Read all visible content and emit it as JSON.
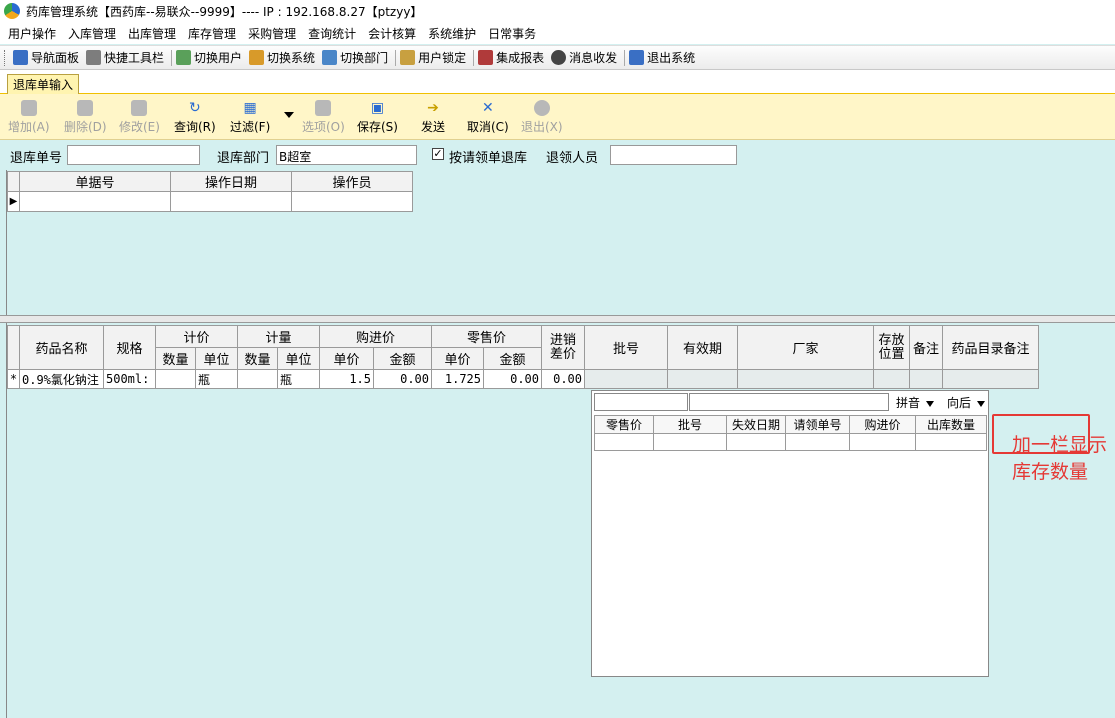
{
  "window": {
    "title": "药库管理系统【西药库--易联众--9999】---- IP : 192.168.8.27【ptzyy】"
  },
  "menu": [
    "用户操作",
    "入库管理",
    "出库管理",
    "库存管理",
    "采购管理",
    "查询统计",
    "会计核算",
    "系统维护",
    "日常事务"
  ],
  "toolbar": {
    "items": [
      {
        "label": "导航面板",
        "icon": "navigation-panel-icon",
        "color": "#3a6fc4"
      },
      {
        "label": "快捷工具栏",
        "icon": "shortcut-toolbar-icon",
        "color": "#7d7d7d"
      },
      {
        "label": "切换用户",
        "icon": "switch-user-icon",
        "color": "#5aa05a"
      },
      {
        "label": "切换系统",
        "icon": "switch-system-icon",
        "color": "#d89a2a"
      },
      {
        "label": "切换部门",
        "icon": "switch-department-icon",
        "color": "#4a86c8"
      },
      {
        "label": "用户锁定",
        "icon": "user-lock-icon",
        "color": "#c8a040"
      },
      {
        "label": "集成报表",
        "icon": "integrated-report-icon",
        "color": "#b03a3a"
      },
      {
        "label": "消息收发",
        "icon": "message-icon",
        "color": "#444444"
      },
      {
        "label": "退出系统",
        "icon": "exit-system-icon",
        "color": "#3a6fc4"
      }
    ]
  },
  "tab": {
    "label": "退库单输入"
  },
  "actions": {
    "add": "增加(A)",
    "delete": "删除(D)",
    "modify": "修改(E)",
    "query": "查询(R)",
    "filter": "过滤(F)",
    "options": "选项(O)",
    "save": "保存(S)",
    "send": "发送",
    "cancel": "取消(C)",
    "exit": "退出(X)"
  },
  "form": {
    "return_no_label": "退库单号",
    "return_no_value": "",
    "dept_label": "退库部门",
    "dept_value": "B超室",
    "by_request_label": "按请领单退库",
    "by_request_checked": "✓",
    "returner_label": "退领人员",
    "returner_value": ""
  },
  "grid1": {
    "headers": [
      "单据号",
      "操作日期",
      "操作员"
    ]
  },
  "grid2": {
    "h_name": "药品名称",
    "h_spec": "规格",
    "h_pricing": "计价",
    "h_measure": "计量",
    "h_purchase": "购进价",
    "h_retail": "零售价",
    "h_diff": "进销差价",
    "h_batch": "批号",
    "h_expiry": "有效期",
    "h_maker": "厂家",
    "h_location": "存放位置",
    "h_note": "备注",
    "h_catalog_note": "药品目录备注",
    "h_qty": "数量",
    "h_unit": "单位",
    "h_unit_price": "单价",
    "h_amount": "金额",
    "row": {
      "marker": "*",
      "name": "0.9%氯化钠注",
      "spec": "500ml:",
      "pricing_qty": "",
      "pricing_unit": "瓶",
      "measure_qty": "",
      "measure_unit": "瓶",
      "purchase_price": "1.5",
      "purchase_amount": "0.00",
      "retail_price": "1.725",
      "retail_amount": "0.00",
      "diff": "0.00"
    }
  },
  "popup": {
    "combo_pinyin": "拼音",
    "combo_direction": "向后",
    "headers": [
      "零售价",
      "批号",
      "失效日期",
      "请领单号",
      "购进价",
      "出库数量"
    ]
  },
  "annotation": {
    "text": "加一栏显示库存数量",
    "color": "#e53935"
  }
}
